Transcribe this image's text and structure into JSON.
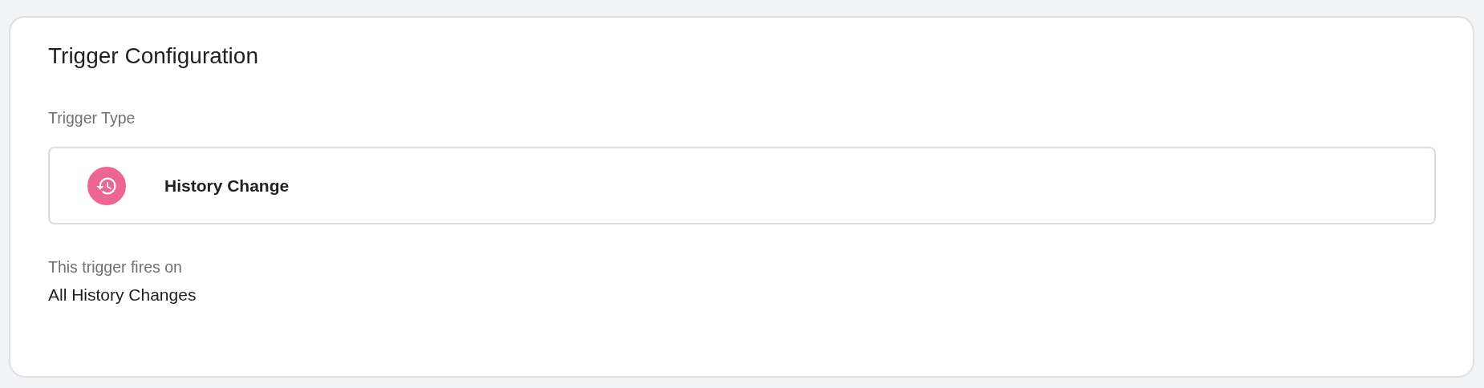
{
  "card": {
    "title": "Trigger Configuration",
    "trigger_type_label": "Trigger Type",
    "trigger_type": {
      "name": "History Change",
      "color": "#ed6592"
    },
    "fires_on_label": "This trigger fires on",
    "fires_on_value": "All History Changes"
  }
}
